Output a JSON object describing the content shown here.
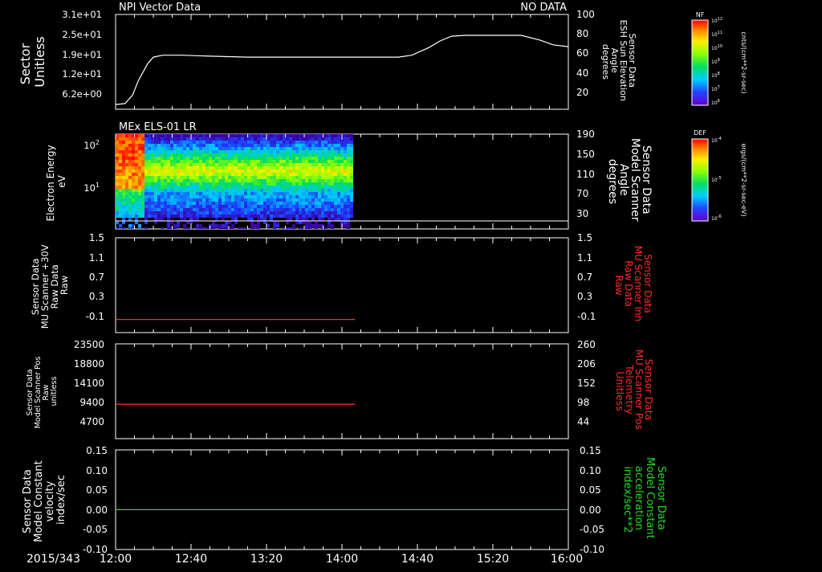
{
  "date_label": "2015/343",
  "time_axis": {
    "ticks": [
      "12:00",
      "12:40",
      "13:20",
      "14:00",
      "14:40",
      "15:20",
      "16:00"
    ]
  },
  "chart_data": [
    {
      "type": "line",
      "title_left": "NPI Vector Data",
      "title_right": "NO DATA",
      "ylabel_left": [
        "Sector",
        "Unitless"
      ],
      "left_ticks": [
        "3.1e+01",
        "2.5e+01",
        "1.9e+01",
        "1.2e+01",
        "6.2e+00"
      ],
      "ylabel_right": [
        "Sensor Data",
        "ESH Sun Elevation",
        "Angle",
        "degrees"
      ],
      "right_ticks": [
        "100",
        "80",
        "60",
        "40",
        "20"
      ],
      "ylim_right": [
        0,
        100
      ],
      "series": [
        {
          "color": "#ffffff",
          "x": [
            "12:00",
            "12:05",
            "12:09",
            "12:12",
            "12:17",
            "12:20",
            "12:25",
            "12:35",
            "12:50",
            "13:10",
            "13:40",
            "14:10",
            "14:30",
            "14:37",
            "14:46",
            "14:52",
            "14:58",
            "15:05",
            "15:20",
            "15:35",
            "15:45",
            "15:52",
            "16:00"
          ],
          "y": [
            5,
            6,
            15,
            30,
            48,
            55,
            57,
            57,
            56,
            55,
            55,
            55,
            55,
            57,
            65,
            72,
            77,
            78,
            78,
            78,
            73,
            68,
            66
          ]
        }
      ]
    },
    {
      "type": "heatmap",
      "title_left": "MEx ELS-01 LR",
      "ylabel_left": [
        "Electron Energy",
        "eV"
      ],
      "left_ticks": [
        "10^2",
        "10^1"
      ],
      "ylabel_right": [
        "Sensor Data",
        "Model Scanner",
        "Angle",
        "degrees"
      ],
      "right_ticks": [
        "190",
        "150",
        "110",
        "70",
        "30"
      ],
      "data_end": "14:05",
      "reference_line_degrees": 10
    },
    {
      "type": "line",
      "ylabel_left": [
        "Sensor Data",
        "MU Scanner +30V",
        "Raw Data",
        "Raw"
      ],
      "left_ticks": [
        "1.5",
        "1.1",
        "0.7",
        "0.3",
        "-0.1"
      ],
      "ylim_left": [
        -0.3,
        1.5
      ],
      "ylabel_right": [
        "Sensor Data",
        "MU Scanner Inh",
        "Raw Data",
        "Raw"
      ],
      "right_ticks": [
        "1.5",
        "1.1",
        "0.7",
        "0.3",
        "-0.1"
      ],
      "series": [
        {
          "color": "#ff2a2a",
          "x": [
            "12:00",
            "14:07"
          ],
          "y": [
            -0.05,
            -0.05
          ]
        }
      ]
    },
    {
      "type": "line",
      "ylabel_left": [
        "Sensor Data",
        "Model Scanner Pos",
        "Raw",
        "unitless"
      ],
      "left_ticks": [
        "23500",
        "18800",
        "14100",
        "9400",
        "4700"
      ],
      "ylim_left": [
        0,
        23500
      ],
      "ylabel_right": [
        "Sensor Data",
        "MU Scanner Pos",
        "Telemetry",
        "Unitless"
      ],
      "right_ticks": [
        "260",
        "206",
        "152",
        "98",
        "44"
      ],
      "series": [
        {
          "color": "#ff2a2a",
          "x": [
            "12:00",
            "14:07"
          ],
          "y": [
            8550,
            8550
          ]
        }
      ]
    },
    {
      "type": "line",
      "ylabel_left": [
        "Sensor Data",
        "Model Constant",
        "velocity",
        "index/sec"
      ],
      "left_ticks": [
        "0.15",
        "0.10",
        "0.05",
        "0.00",
        "-0.05",
        "-0.10"
      ],
      "ylim_left": [
        -0.1,
        0.15
      ],
      "ylabel_right": [
        "Sensor Data",
        "Model Constant",
        "acceleration",
        "index/sec**2"
      ],
      "right_ticks": [
        "0.15",
        "0.10",
        "0.05",
        "0.00",
        "-0.05",
        "-0.10"
      ],
      "series": [
        {
          "color": "#22dd22",
          "x": [
            "12:00",
            "16:00"
          ],
          "y": [
            0.0,
            0.0
          ]
        }
      ]
    }
  ],
  "colorbars": [
    {
      "label": "NF",
      "units": "cnts/(cm**2-sr-sec)",
      "ticks": [
        "10^12",
        "10^11",
        "10^10",
        "10^9",
        "10^8",
        "10^7",
        "10^6"
      ]
    },
    {
      "label": "DEF",
      "units": "ergs/(cm**2-sr-sec-eV)",
      "ticks": [
        "10^-4",
        "10^-5",
        "10^-6"
      ]
    }
  ]
}
